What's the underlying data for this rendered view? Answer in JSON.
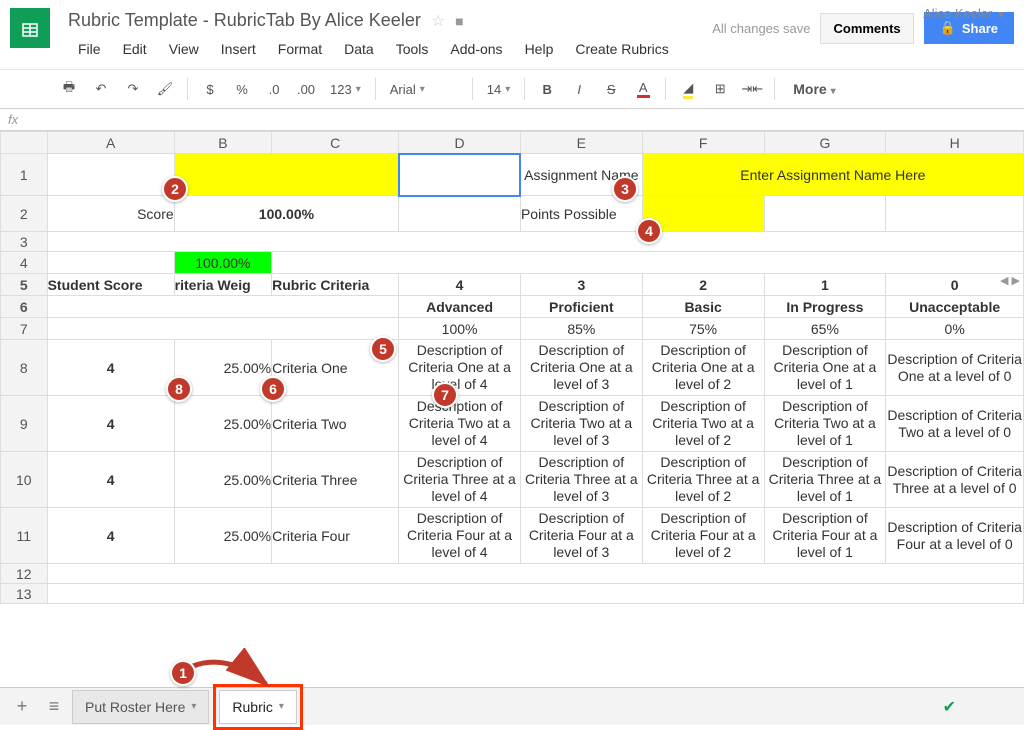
{
  "docTitle": "Rubric Template - RubricTab By Alice Keeler",
  "account": "Alice Keeler",
  "saveStatus": "All changes save",
  "buttons": {
    "comments": "Comments",
    "share": "Share",
    "more": "More"
  },
  "menu": [
    "File",
    "Edit",
    "View",
    "Insert",
    "Format",
    "Data",
    "Tools",
    "Add-ons",
    "Help",
    "Create Rubrics"
  ],
  "toolbar": {
    "font": "Arial",
    "size": "14"
  },
  "fx": "fx",
  "columns": [
    "",
    "A",
    "B",
    "C",
    "D",
    "E",
    "F",
    "G",
    "H"
  ],
  "rows": {
    "r1": {
      "e": "Assignment Name",
      "f": "Enter Assignment Name Here"
    },
    "r2": {
      "a": "Score",
      "bc": "100.00%",
      "e": "Points Possible"
    },
    "r4": {
      "b": "100.00%"
    },
    "r5": {
      "a": "Student Score",
      "b": "riteria Weig",
      "c": "Rubric Criteria",
      "d": "4",
      "e": "3",
      "f": "2",
      "g": "1",
      "h": "0"
    },
    "r6": {
      "d": "Advanced",
      "e": "Proficient",
      "f": "Basic",
      "g": "In Progress",
      "h": "Unacceptable"
    },
    "r7": {
      "d": "100%",
      "e": "85%",
      "f": "75%",
      "g": "65%",
      "h": "0%"
    }
  },
  "criteria": [
    {
      "row": "8",
      "score": "4",
      "weight": "25.00%",
      "name": "Criteria One",
      "d": "Description of Criteria One at a level of 4",
      "e": "Description of Criteria One at a level of 3",
      "f": "Description of Criteria One at a level of 2",
      "g": "Description of Criteria One at a level of 1",
      "h": "Description of Criteria One at a level of 0"
    },
    {
      "row": "9",
      "score": "4",
      "weight": "25.00%",
      "name": "Criteria Two",
      "d": "Description of Criteria Two at a level of 4",
      "e": "Description of Criteria Two at a level of 3",
      "f": "Description of Criteria Two at a level of 2",
      "g": "Description of Criteria Two at a level of 1",
      "h": "Description of Criteria Two at a level of 0"
    },
    {
      "row": "10",
      "score": "4",
      "weight": "25.00%",
      "name": "Criteria Three",
      "d": "Description of Criteria Three at a level of 4",
      "e": "Description of Criteria Three at a level of 3",
      "f": "Description of Criteria Three at a level of 2",
      "g": "Description of Criteria Three at a level of 1",
      "h": "Description of Criteria Three at a level of 0"
    },
    {
      "row": "11",
      "score": "4",
      "weight": "25.00%",
      "name": "Criteria Four",
      "d": "Description of Criteria Four at a level of 4",
      "e": "Description of Criteria Four at a level of 3",
      "f": "Description of Criteria Four at a level of 2",
      "g": "Description of Criteria Four at a level of 1",
      "h": "Description of Criteria Four at a level of 0"
    }
  ],
  "extraRows": [
    "12",
    "13"
  ],
  "sheets": {
    "tab1": "Put Roster Here",
    "tab2": "Rubric"
  },
  "annotations": {
    "a1": "1",
    "a2": "2",
    "a3": "3",
    "a4": "4",
    "a5": "5",
    "a6": "6",
    "a7": "7",
    "a8": "8"
  }
}
